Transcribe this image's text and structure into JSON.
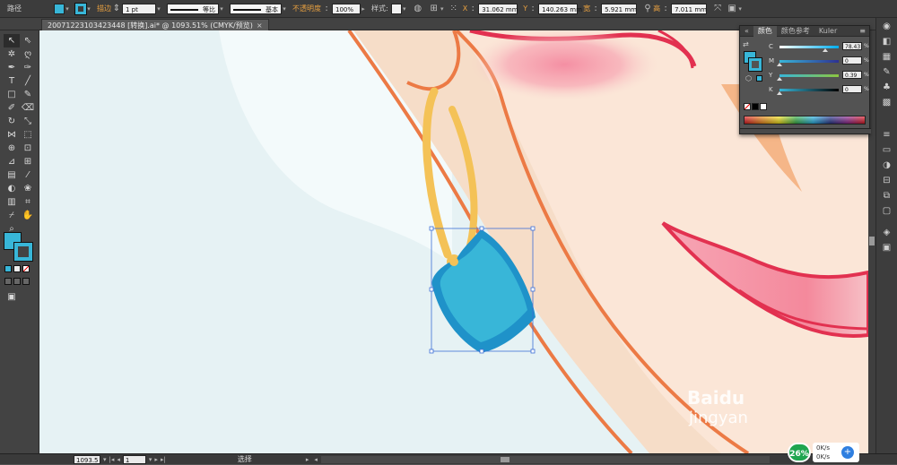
{
  "topbar": {
    "path_label": "路径",
    "fill_color": "#38b6d8",
    "stroke_label": "描边",
    "stroke_weight": "1 pt",
    "stroke_profile": "等比",
    "brush": "基本",
    "opacity_label": "不透明度",
    "opacity_value": "100%",
    "style_label": "样式",
    "x_label": "X",
    "x_value": "31.062 mm",
    "y_label": "Y",
    "y_value": "140.263 mm",
    "w_label": "宽",
    "w_value": "5.921 mm",
    "h_label": "高",
    "h_value": "7.011 mm"
  },
  "document_tab": {
    "title": "20071223103423448 [转换].ai* @ 1093.51% (CMYK/预览)",
    "close": "×"
  },
  "color_panel": {
    "tabs": [
      "颜色",
      "颜色参考",
      "Kuler"
    ],
    "rows": [
      {
        "letter": "C",
        "value": "78.43",
        "pct": "%",
        "level": 0.78,
        "gradient": "linear-gradient(to right,#ffffff,#00aeef)"
      },
      {
        "letter": "M",
        "value": "0",
        "pct": "%",
        "level": 0.0,
        "gradient": "linear-gradient(to right,#38b6d8,#2e3192)"
      },
      {
        "letter": "Y",
        "value": "0.39",
        "pct": "%",
        "level": 0.0,
        "gradient": "linear-gradient(to right,#38b6d8,#8dc63f)"
      },
      {
        "letter": "K",
        "value": "0",
        "pct": "%",
        "level": 0.0,
        "gradient": "linear-gradient(to right,#38b6d8,#000000)"
      }
    ]
  },
  "statusbar": {
    "zoom": "1093.5",
    "artboard": "1",
    "tool": "选择"
  },
  "overlay": {
    "watermark": "Baidu",
    "watermark_sub": "jingyan",
    "net_percent": "26%",
    "net_up": "0K/s",
    "net_down": "0K/s",
    "net_plus": "+"
  }
}
